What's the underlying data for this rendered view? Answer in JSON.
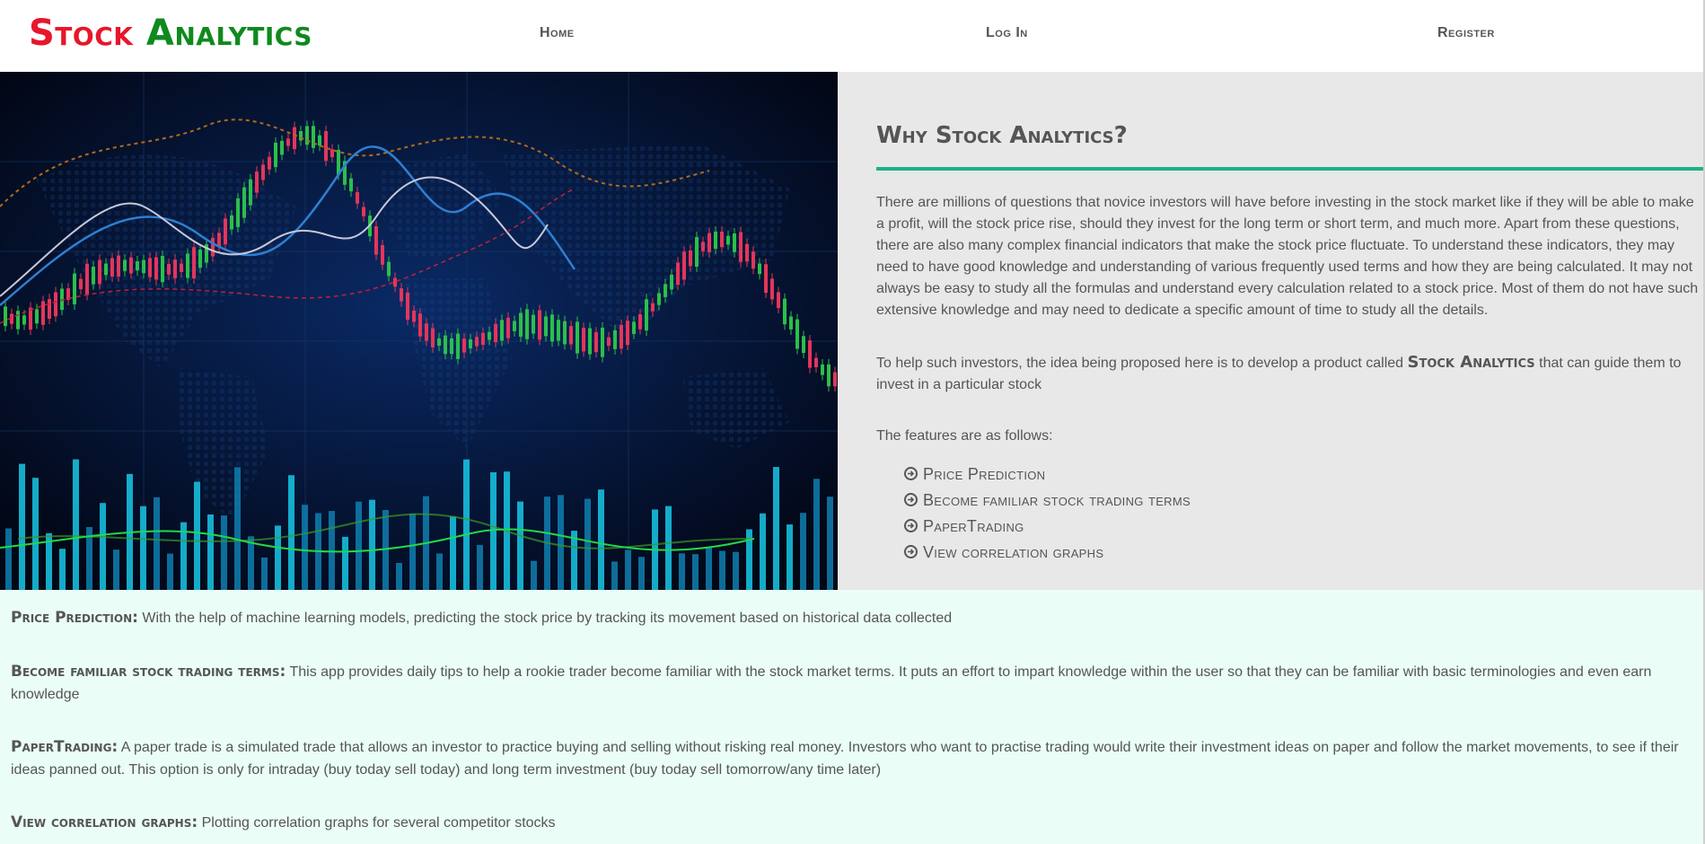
{
  "brand": {
    "word1": "Stock",
    "word2": "Analytics"
  },
  "nav": {
    "home": "Home",
    "login": "Log In",
    "register": "Register"
  },
  "colors": {
    "brand_red": "#e8162b",
    "brand_green": "#0f8a1e",
    "rule_green": "#1fb08a",
    "panel_gray": "#e8e8e8",
    "details_bg": "#eafdf6"
  },
  "why": {
    "title": "Why Stock Analytics?",
    "para1": "There are millions of questions that novice investors will have before investing in the stock market like if they will be able to make a profit, will the stock price rise, should they invest for the long term or short term, and much more. Apart from these questions, there are also many complex financial indicators that make the stock price fluctuate. To understand these indicators, they may need to have good knowledge and understanding of various frequently used terms and how they are being calculated. It may not always be easy to study all the formulas and understand every calculation related to a stock price. Most of them do not have such extensive knowledge and may need to dedicate a specific amount of time to study all the details.",
    "para2_before": "To help such investors, the idea being proposed here is to develop a product called ",
    "para2_brand": "Stock Analytics",
    "para2_after": " that can guide them to invest in a particular stock",
    "features_intro": "The features are as follows:",
    "features": [
      "Price Prediction",
      "Become familiar stock trading terms",
      "PaperTrading",
      "View correlation graphs"
    ],
    "feature_icon": "circle-arrow-right-icon"
  },
  "details": [
    {
      "term": "Price Prediction:",
      "text": " With the help of machine learning models, predicting the stock price by tracking its movement based on historical data collected"
    },
    {
      "term": "Become familiar stock trading terms:",
      "text": " This app provides daily tips to help a rookie trader become familiar with the stock market terms. It puts an effort to impart knowledge within the user so that they can be familiar with basic terminologies and even earn knowledge"
    },
    {
      "term": "PaperTrading:",
      "text": " A paper trade is a simulated trade that allows an investor to practice buying and selling without risking real money. Investors who want to practise trading would write their investment ideas on paper and follow the market movements, to see if their ideas panned out. This option is only for intraday (buy today sell today) and long term investment (buy today sell tomorrow/any time later)"
    },
    {
      "term": "View correlation graphs:",
      "text": " Plotting correlation graphs for several competitor stocks"
    }
  ]
}
